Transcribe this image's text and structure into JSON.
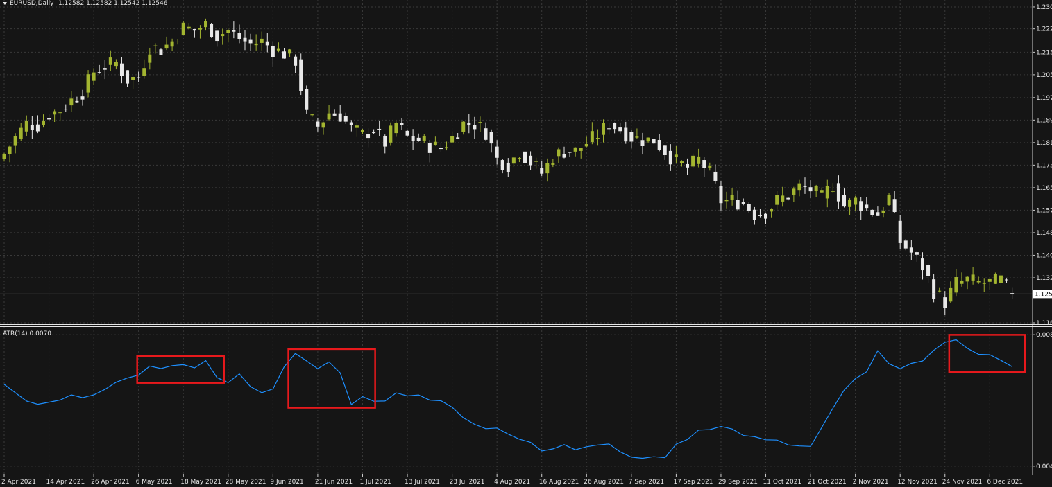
{
  "header": {
    "symbol": "EURUSD,Daily",
    "ohlc": "1.12582 1.12582 1.12542 1.12546"
  },
  "indicator": {
    "label": "ATR(14) 0.0070"
  },
  "colors": {
    "background": "#151515",
    "grid": "#3a3a3a",
    "bull": "#a3b530",
    "bear": "#e8e8e8",
    "atr_line": "#1e90ff",
    "highlight": "#e8191c",
    "price_label_bg": "#ffffff"
  },
  "chart_data": [
    {
      "type": "candlestick",
      "title": "EURUSD,Daily",
      "price_axis_ticks": [
        "1.230",
        "1.222",
        "1.213",
        "1.205",
        "1.197",
        "1.189",
        "1.181",
        "1.173",
        "1.165",
        "1.157",
        "1.148",
        "1.140",
        "1.132",
        "1.116"
      ],
      "price_axis_tick_values": [
        1.23,
        1.222,
        1.2135,
        1.2053,
        1.197,
        1.1888,
        1.1806,
        1.1724,
        1.1642,
        1.156,
        1.1478,
        1.1396,
        1.1314,
        1.115
      ],
      "current_price_label": "1.125",
      "current_price": 1.1255,
      "ylim": [
        1.115,
        1.2315
      ],
      "date_axis_labels": [
        "2 Apr 2021",
        "14 Apr 2021",
        "26 Apr 2021",
        "6 May 2021",
        "18 May 2021",
        "28 May 2021",
        "9 Jun 2021",
        "21 Jun 2021",
        "1 Jul 2021",
        "13 Jul 2021",
        "23 Jul 2021",
        "4 Aug 2021",
        "16 Aug 2021",
        "26 Aug 2021",
        "7 Sep 2021",
        "17 Sep 2021",
        "29 Sep 2021",
        "11 Oct 2021",
        "21 Oct 2021",
        "2 Nov 2021",
        "12 Nov 2021",
        "24 Nov 2021",
        "6 Dec 2021"
      ],
      "date_label_bar_index": [
        0,
        8,
        16,
        24,
        32,
        40,
        48,
        56,
        64,
        72,
        80,
        88,
        96,
        104,
        112,
        120,
        128,
        136,
        144,
        152,
        160,
        168,
        176
      ],
      "grid": true,
      "close_path": [
        [
          0,
          1.1765
        ],
        [
          2,
          1.1825
        ],
        [
          4,
          1.1875
        ],
        [
          6,
          1.187
        ],
        [
          8,
          1.191
        ],
        [
          10,
          1.1925
        ],
        [
          12,
          1.196
        ],
        [
          14,
          1.199
        ],
        [
          16,
          1.2065
        ],
        [
          18,
          1.2085
        ],
        [
          20,
          1.2095
        ],
        [
          22,
          1.2035
        ],
        [
          24,
          1.2045
        ],
        [
          26,
          1.2155
        ],
        [
          28,
          1.2145
        ],
        [
          30,
          1.2175
        ],
        [
          32,
          1.2225
        ],
        [
          34,
          1.2215
        ],
        [
          36,
          1.2235
        ],
        [
          38,
          1.2195
        ],
        [
          40,
          1.2215
        ],
        [
          42,
          1.2185
        ],
        [
          44,
          1.2165
        ],
        [
          46,
          1.2175
        ],
        [
          48,
          1.2145
        ],
        [
          50,
          1.213
        ],
        [
          52,
          1.2105
        ],
        [
          54,
          1.1905
        ],
        [
          56,
          1.1865
        ],
        [
          58,
          1.1915
        ],
        [
          60,
          1.1905
        ],
        [
          62,
          1.1855
        ],
        [
          64,
          1.1835
        ],
        [
          66,
          1.1855
        ],
        [
          68,
          1.1805
        ],
        [
          70,
          1.1875
        ],
        [
          72,
          1.1825
        ],
        [
          74,
          1.1815
        ],
        [
          76,
          1.1795
        ],
        [
          78,
          1.1785
        ],
        [
          80,
          1.1825
        ],
        [
          82,
          1.1875
        ],
        [
          84,
          1.1875
        ],
        [
          86,
          1.1845
        ],
        [
          88,
          1.1745
        ],
        [
          90,
          1.1725
        ],
        [
          92,
          1.1775
        ],
        [
          94,
          1.1735
        ],
        [
          96,
          1.1695
        ],
        [
          98,
          1.1755
        ],
        [
          100,
          1.1775
        ],
        [
          102,
          1.1775
        ],
        [
          104,
          1.1805
        ],
        [
          106,
          1.1835
        ],
        [
          108,
          1.1875
        ],
        [
          110,
          1.1855
        ],
        [
          112,
          1.1825
        ],
        [
          114,
          1.1815
        ],
        [
          116,
          1.1815
        ],
        [
          118,
          1.1775
        ],
        [
          120,
          1.1735
        ],
        [
          122,
          1.1715
        ],
        [
          124,
          1.1745
        ],
        [
          126,
          1.1695
        ],
        [
          128,
          1.1595
        ],
        [
          130,
          1.1595
        ],
        [
          132,
          1.1585
        ],
        [
          134,
          1.1545
        ],
        [
          136,
          1.1555
        ],
        [
          138,
          1.1595
        ],
        [
          140,
          1.1615
        ],
        [
          142,
          1.1645
        ],
        [
          144,
          1.1635
        ],
        [
          146,
          1.1605
        ],
        [
          148,
          1.1655
        ],
        [
          150,
          1.1575
        ],
        [
          152,
          1.1595
        ],
        [
          154,
          1.1565
        ],
        [
          156,
          1.1545
        ],
        [
          158,
          1.1605
        ],
        [
          160,
          1.1445
        ],
        [
          162,
          1.1405
        ],
        [
          164,
          1.1355
        ],
        [
          166,
          1.1265
        ],
        [
          168,
          1.1225
        ],
        [
          170,
          1.1295
        ],
        [
          172,
          1.1305
        ],
        [
          174,
          1.1295
        ],
        [
          176,
          1.1295
        ],
        [
          178,
          1.1305
        ],
        [
          180,
          1.1255
        ]
      ]
    },
    {
      "type": "line",
      "title": "ATR(14) 0.0070",
      "ylim": [
        0.0042,
        0.0081
      ],
      "axis_ticks": [
        "0.008",
        "0.0043"
      ],
      "axis_tick_values": [
        0.008,
        0.0043
      ],
      "x": [
        0,
        2,
        4,
        6,
        8,
        10,
        12,
        14,
        16,
        18,
        20,
        22,
        24,
        26,
        28,
        30,
        32,
        34,
        36,
        38,
        40,
        42,
        44,
        46,
        48,
        50,
        52,
        54,
        56,
        58,
        60,
        62,
        64,
        66,
        68,
        70,
        72,
        74,
        76,
        78,
        80,
        82,
        84,
        86,
        88,
        90,
        92,
        94,
        96,
        98,
        100,
        102,
        104,
        106,
        108,
        110,
        112,
        114,
        116,
        118,
        120,
        122,
        124,
        126,
        128,
        130,
        132,
        134,
        136,
        138,
        140,
        142,
        144,
        146,
        148,
        150,
        152,
        154,
        156,
        158,
        160,
        162,
        164,
        166,
        168,
        170,
        172,
        174,
        176,
        178,
        180
      ],
      "values": [
        0.0066,
        0.0064,
        0.0062,
        0.006,
        0.0061,
        0.0062,
        0.0063,
        0.0062,
        0.0063,
        0.0065,
        0.0067,
        0.0068,
        0.0069,
        0.0071,
        0.0071,
        0.0072,
        0.0072,
        0.0071,
        0.0072,
        0.0068,
        0.0067,
        0.0069,
        0.0065,
        0.0064,
        0.0064,
        0.0071,
        0.0074,
        0.0072,
        0.0071,
        0.0072,
        0.0069,
        0.0061,
        0.0062,
        0.0061,
        0.0061,
        0.0063,
        0.0063,
        0.0063,
        0.0062,
        0.0062,
        0.0059,
        0.0057,
        0.0055,
        0.0054,
        0.0054,
        0.0052,
        0.005,
        0.0049,
        0.0048,
        0.0048,
        0.0049,
        0.0048,
        0.0049,
        0.0049,
        0.0049,
        0.0047,
        0.0046,
        0.0045,
        0.0045,
        0.0046,
        0.0049,
        0.005,
        0.0053,
        0.0054,
        0.0054,
        0.0054,
        0.0052,
        0.0051,
        0.0051,
        0.005,
        0.0049,
        0.0048,
        0.0048,
        0.0054,
        0.006,
        0.0065,
        0.0067,
        0.0069,
        0.0075,
        0.0072,
        0.007,
        0.0072,
        0.0073,
        0.0076,
        0.0078,
        0.0078,
        0.0076,
        0.0075,
        0.0074,
        0.0073,
        0.0071
      ],
      "highlight_boxes": [
        [
          24,
          39
        ],
        [
          51,
          66
        ],
        [
          169,
          182
        ]
      ]
    }
  ]
}
